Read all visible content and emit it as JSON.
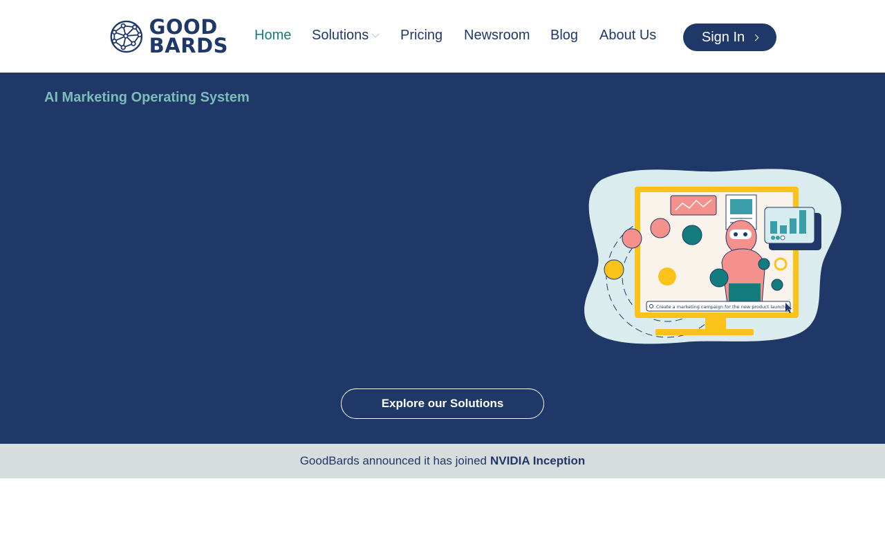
{
  "brand": {
    "name_line1": "GOOD",
    "name_line2": "BARDS",
    "color": "#1f3868"
  },
  "nav": {
    "items": [
      {
        "label": "Home",
        "active": true
      },
      {
        "label": "Solutions",
        "has_dropdown": true
      },
      {
        "label": "Pricing"
      },
      {
        "label": "Newsroom"
      },
      {
        "label": "Blog"
      },
      {
        "label": "About Us"
      }
    ],
    "signin_label": "Sign In",
    "active_color": "#127d7c"
  },
  "hero": {
    "tagline": "AI Marketing Operating System",
    "cta_label": "Explore our Solutions",
    "background": "#1f3868",
    "illustration": {
      "prompt_text": "Create a marketing campaign for the new product launch"
    }
  },
  "announcement": {
    "text": "GoodBards announced it has joined",
    "highlight": "NVIDIA Inception"
  }
}
